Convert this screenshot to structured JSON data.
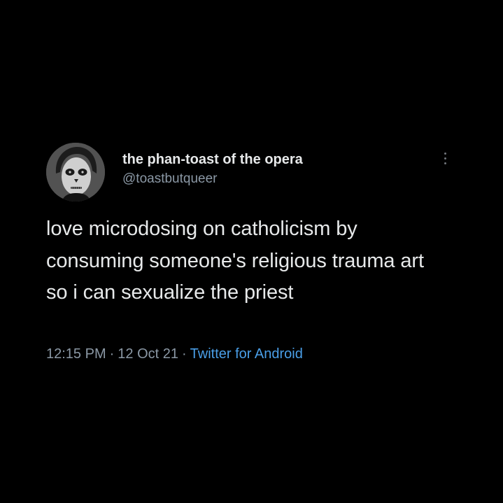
{
  "tweet": {
    "author": {
      "display_name": "the phan-toast of the opera",
      "handle": "@toastbutqueer"
    },
    "text": "love microdosing on catholicism by consuming someone's religious trauma art so i can sexualize the priest",
    "time": "12:15 PM",
    "date": "12 Oct 21",
    "separator": "·",
    "source": "Twitter for Android"
  },
  "icons": {
    "more": "more-vertical-icon"
  },
  "colors": {
    "background": "#000000",
    "primary_text": "#e7e9ea",
    "secondary_text": "#8b98a5",
    "link": "#4a9fe8"
  }
}
